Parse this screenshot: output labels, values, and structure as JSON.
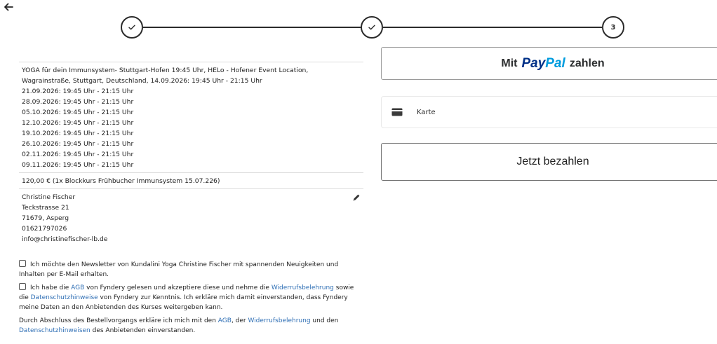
{
  "stepper": {
    "step3_label": "3"
  },
  "order": {
    "event_lines": [
      "YOGA für dein Immunsystem- Stuttgart-Hofen 19:45 Uhr, HELo - Hofener Event Location,",
      "Wagrainstraße, Stuttgart, Deutschland, 14.09.2026: 19:45 Uhr - 21:15 Uhr",
      "21.09.2026: 19:45 Uhr - 21:15 Uhr",
      "28.09.2026: 19:45 Uhr - 21:15 Uhr",
      "05.10.2026: 19:45 Uhr - 21:15 Uhr",
      "12.10.2026: 19:45 Uhr - 21:15 Uhr",
      "19.10.2026: 19:45 Uhr - 21:15 Uhr",
      "26.10.2026: 19:45 Uhr - 21:15 Uhr",
      "02.11.2026: 19:45 Uhr - 21:15 Uhr",
      "09.11.2026: 19:45 Uhr - 21:15 Uhr"
    ],
    "price_line": "120,00 € (1x Blockkurs Frühbucher Immunsystem 15.07.226)",
    "address": {
      "name": "Christine Fischer",
      "street": "Teckstrasse 21",
      "city": "71679, Asperg",
      "phone": "01621797026",
      "email": "info@christinefischer-lb.de"
    }
  },
  "consent": {
    "newsletter_text": "Ich möchte den Newsletter von Kundalini Yoga Christine Fischer mit spannenden Neuigkeiten und Inhalten per E-Mail erhalten.",
    "agb": {
      "t1": "Ich habe die ",
      "link_agb": "AGB",
      "t2": " von Fyndery gelesen und akzeptiere diese und nehme die ",
      "link_widerruf": "Widerrufsbelehrung",
      "t3": " sowie die ",
      "link_datenschutz": "Datenschutzhinweise",
      "t4": " von Fyndery zur Kenntnis. Ich erkläre mich damit einverstanden, dass Fyndery meine Daten an den Anbietenden des Kurses weitergeben kann."
    },
    "closing": {
      "t1": "Durch Abschluss des Bestellvorgangs erkläre ich mich mit den ",
      "link_agb": "AGB",
      "t2": ", der ",
      "link_widerruf": "Widerrufsbelehrung",
      "t3": " und den ",
      "link_datenschutz": "Datenschutzhinweisen",
      "t4": " des Anbietenden einverstanden."
    }
  },
  "payment": {
    "paypal_prefix": "Mit",
    "paypal_brand_1": "Pay",
    "paypal_brand_2": "Pal",
    "paypal_suffix": "zahlen",
    "card_label": "Karte",
    "pay_now_label": "Jetzt bezahlen"
  },
  "icons": {
    "back": "arrow-left-icon",
    "step_done": "check-icon",
    "edit": "pencil-icon",
    "card": "credit-card-icon"
  }
}
